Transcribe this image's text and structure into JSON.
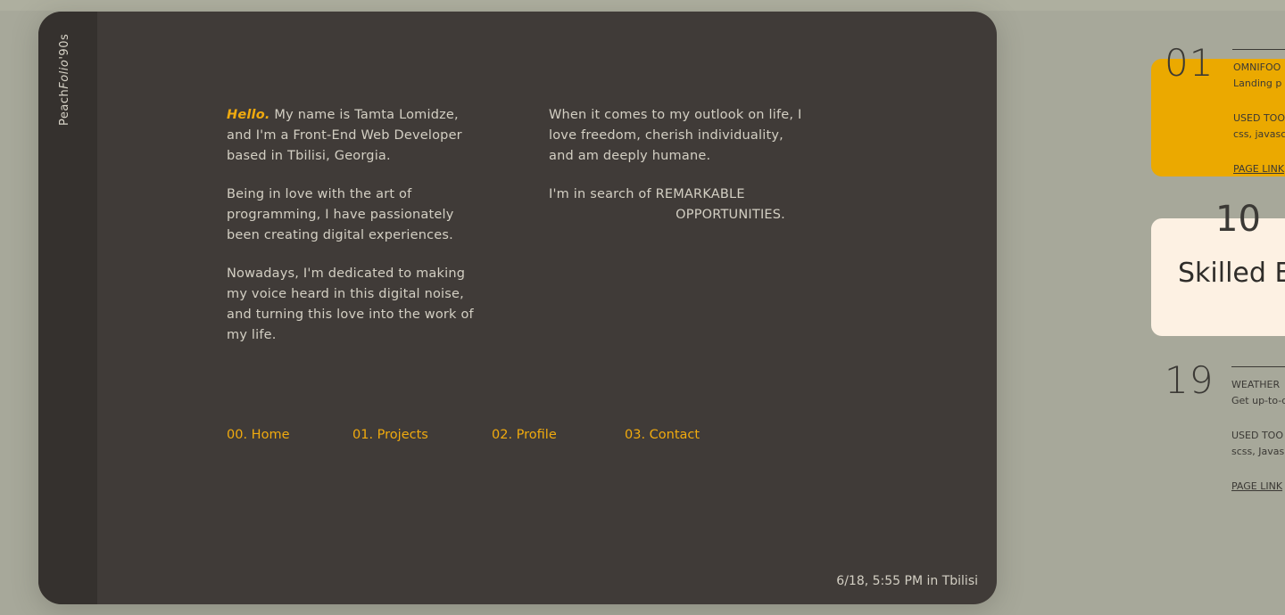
{
  "brand": {
    "pre": "Peach",
    "italic": "Folio",
    "post": "'90s"
  },
  "intro": {
    "hello": "Hello.",
    "p1_rest": " My name is Tamta Lomidze, and I'm a Front-End Web Developer based in Tbilisi, Georgia.",
    "p2": "Being in love with the art of programming, I have passionately been creating digital experiences.",
    "p3": "Nowadays, I'm dedicated to making my voice heard in this digital noise, and turning this love into the work of my life.",
    "p4": "When it comes to my outlook on life, I love freedom, cherish individuality, and am deeply humane.",
    "p5_line1": "I'm in search of REMARKABLE",
    "p5_line2": "OPPORTUNITIES."
  },
  "nav": [
    {
      "label": "00. Home"
    },
    {
      "label": "01. Projects"
    },
    {
      "label": "02. Profile"
    },
    {
      "label": "03. Contact"
    }
  ],
  "clock": "6/18, 5:55 PM in Tbilisi",
  "projects": [
    {
      "num": "01",
      "name": "OMNIFOO",
      "desc": "Landing p",
      "tools_label": "USED TOO",
      "tools": "css, javasc",
      "link": "PAGE LINK"
    },
    {
      "num": "19",
      "name": "WEATHER",
      "desc": "Get up-to-d",
      "tools_label": "USED TOO",
      "tools": "scss, Javas",
      "link": "PAGE LINK"
    }
  ],
  "skill_card": {
    "num": "10",
    "title": "Skilled E"
  },
  "colors": {
    "accent": "#f0aa0e",
    "panel": "#403b38",
    "background": "#a7a89a",
    "card_yellow": "#eba900",
    "card_cream": "#fdf1e3"
  }
}
